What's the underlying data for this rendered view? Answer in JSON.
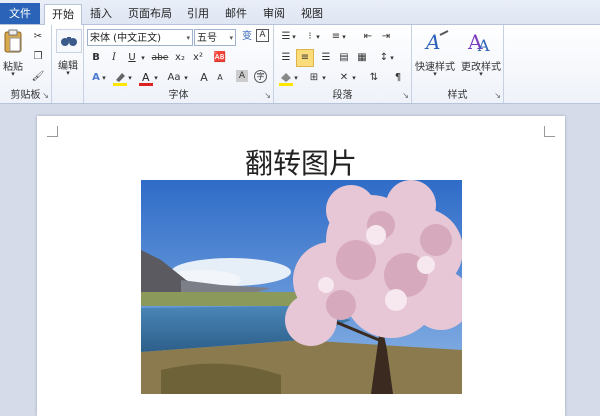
{
  "tabs": {
    "file": "文件",
    "items": [
      "开始",
      "插入",
      "页面布局",
      "引用",
      "邮件",
      "审阅",
      "视图"
    ]
  },
  "ribbon": {
    "clipboard": {
      "paste_label": "粘贴",
      "group_label": "剪贴板"
    },
    "editing": {
      "label": "编辑"
    },
    "font": {
      "font_name": "宋体 (中文正文)",
      "font_size": "五号",
      "group_label": "字体",
      "bold": "B",
      "italic": "I",
      "underline": "U",
      "strike": "abe",
      "subscript": "x₂",
      "superscript": "x²",
      "change_case": "Aa",
      "grow": "A",
      "shrink": "A"
    },
    "paragraph": {
      "group_label": "段落"
    },
    "styles": {
      "quick_styles": "快速样式",
      "change_styles": "更改样式",
      "group_label": "样式"
    }
  },
  "document": {
    "title": "翻转图片"
  },
  "colors": {
    "file_tab": "#2a63b7",
    "accent": "#fbdc7a",
    "font_red": "#d22"
  }
}
